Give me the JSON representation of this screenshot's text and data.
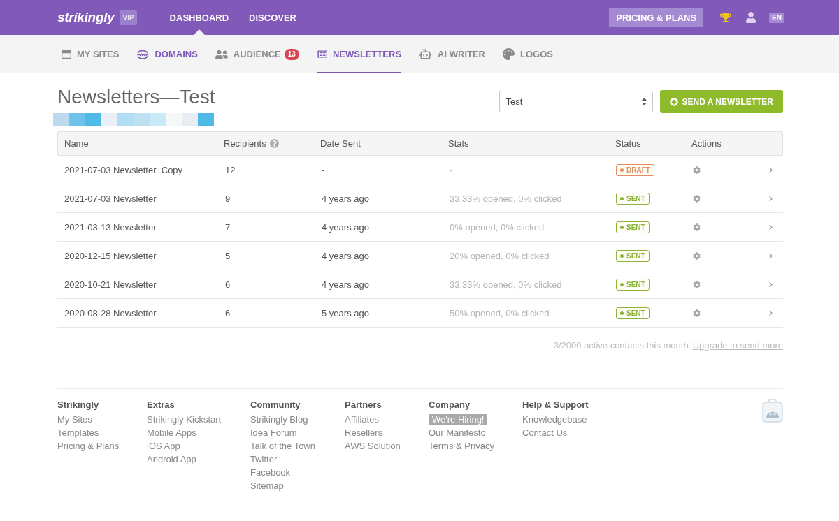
{
  "top_bar": {
    "logo": "strikingly",
    "badge": "VIP",
    "nav": [
      {
        "label": "DASHBOARD",
        "selected": true
      },
      {
        "label": "DISCOVER",
        "selected": false
      }
    ],
    "pricing_button": "PRICING & PLANS",
    "language": "EN"
  },
  "sub_nav": [
    {
      "label": "MY SITES",
      "selected": false,
      "highlighted": false
    },
    {
      "label": "DOMAINS",
      "selected": false,
      "highlighted": true
    },
    {
      "label": "AUDIENCE",
      "selected": false,
      "highlighted": false,
      "badge": "13"
    },
    {
      "label": "NEWSLETTERS",
      "selected": true,
      "highlighted": false
    },
    {
      "label": "AI WRITER",
      "selected": false,
      "highlighted": false
    },
    {
      "label": "LOGOS",
      "selected": false,
      "highlighted": false
    }
  ],
  "page_title": "Newsletters—Test",
  "site_select": {
    "value": "Test"
  },
  "send_button": "SEND A NEWSLETTER",
  "table": {
    "columns": [
      {
        "label": "Name",
        "help": false
      },
      {
        "label": "Recipients",
        "help": true
      },
      {
        "label": "Date Sent",
        "help": false
      },
      {
        "label": "Stats",
        "help": false
      },
      {
        "label": "Status",
        "help": false
      },
      {
        "label": "Actions",
        "help": false
      }
    ],
    "rows": [
      {
        "name": "2021-07-03 Newsletter_Copy",
        "recipients": "12",
        "date_sent": "-",
        "stats": "-",
        "status": {
          "label": "DRAFT",
          "color": "#e28c5f"
        }
      },
      {
        "name": "2021-07-03 Newsletter",
        "recipients": "9",
        "date_sent": "4 years ago",
        "stats": "33.33% opened, 0% clicked",
        "status": {
          "label": "SENT",
          "color": "#8db43a"
        }
      },
      {
        "name": "2021-03-13 Newsletter",
        "recipients": "7",
        "date_sent": "4 years ago",
        "stats": "0% opened, 0% clicked",
        "status": {
          "label": "SENT",
          "color": "#8db43a"
        }
      },
      {
        "name": "2020-12-15 Newsletter",
        "recipients": "5",
        "date_sent": "4 years ago",
        "stats": "20% opened, 0% clicked",
        "status": {
          "label": "SENT",
          "color": "#8db43a"
        }
      },
      {
        "name": "2020-10-21 Newsletter",
        "recipients": "6",
        "date_sent": "4 years ago",
        "stats": "33.33% opened, 0% clicked",
        "status": {
          "label": "SENT",
          "color": "#8db43a"
        }
      },
      {
        "name": "2020-08-28 Newsletter",
        "recipients": "6",
        "date_sent": "5 years ago",
        "stats": "50% opened, 0% clicked",
        "status": {
          "label": "SENT",
          "color": "#8db43a"
        }
      }
    ]
  },
  "usage": {
    "text": "3/2000 active contacts this month",
    "link": "Upgrade to send more"
  },
  "footer": {
    "columns": [
      {
        "heading": "Strikingly",
        "links": [
          {
            "label": "My Sites",
            "highlighted": false
          },
          {
            "label": "Templates",
            "highlighted": false
          },
          {
            "label": "Pricing & Plans",
            "highlighted": false
          }
        ]
      },
      {
        "heading": "Extras",
        "links": [
          {
            "label": "Strikingly Kickstart",
            "highlighted": false
          },
          {
            "label": "Mobile Apps",
            "highlighted": false
          },
          {
            "label": "iOS App",
            "highlighted": false
          },
          {
            "label": "Android App",
            "highlighted": false
          }
        ]
      },
      {
        "heading": "Community",
        "links": [
          {
            "label": "Strikingly Blog",
            "highlighted": false
          },
          {
            "label": "Idea Forum",
            "highlighted": false
          },
          {
            "label": "Talk of the Town",
            "highlighted": false
          },
          {
            "label": "Twitter",
            "highlighted": false
          },
          {
            "label": "Facebook",
            "highlighted": false
          },
          {
            "label": "Sitemap",
            "highlighted": false
          }
        ]
      },
      {
        "heading": "Partners",
        "links": [
          {
            "label": "Affiliates",
            "highlighted": false
          },
          {
            "label": "Resellers",
            "highlighted": false
          },
          {
            "label": "AWS Solution",
            "highlighted": false
          }
        ]
      },
      {
        "heading": "Company",
        "links": [
          {
            "label": "We're Hiring!",
            "highlighted": true
          },
          {
            "label": "Our Manifesto",
            "highlighted": false
          },
          {
            "label": "Terms & Privacy",
            "highlighted": false
          }
        ]
      },
      {
        "heading": "Help & Support",
        "links": [
          {
            "label": "Knowledgebase",
            "highlighted": false
          },
          {
            "label": "Contact Us",
            "highlighted": false
          }
        ]
      }
    ]
  }
}
